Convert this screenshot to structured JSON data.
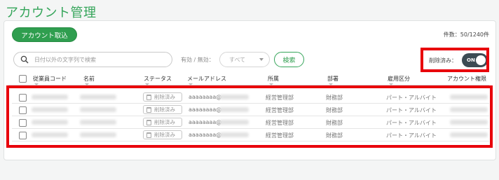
{
  "page": {
    "title": "アカウント管理"
  },
  "toolbar": {
    "import_label": "アカウント取込",
    "count_text": "件数：50/1240件",
    "search_placeholder": "日付以外の文字列で検索",
    "filter_label": "有効 / 無効：",
    "filter_value": "すべて",
    "search_button": "検索",
    "deleted_label": "削除済み：",
    "toggle_text": "ON"
  },
  "table": {
    "columns": [
      "従業員コード",
      "名前",
      "ステータス",
      "メールアドレス",
      "所属",
      "部署",
      "雇用区分",
      "アカウント権限"
    ],
    "rows": [
      {
        "status": "削除済み",
        "email": "aaaaaaaa@",
        "affiliation": "経営管理部",
        "department": "財務部",
        "employment": "パート・アルバイト"
      },
      {
        "status": "削除済み",
        "email": "aaaaaaaa@",
        "affiliation": "経営管理部",
        "department": "財務部",
        "employment": "パート・アルバイト"
      },
      {
        "status": "削除済み",
        "email": "aaaaaaaa@",
        "affiliation": "経営管理部",
        "department": "財務部",
        "employment": "パート・アルバイト"
      },
      {
        "status": "削除済み",
        "email": "aaaaaaaa@",
        "affiliation": "経営管理部",
        "department": "財務部",
        "employment": "パート・アルバイト"
      }
    ]
  },
  "colors": {
    "brand_green": "#35a55a",
    "highlight_red": "#e8000b",
    "toggle_dark": "#3c4b53"
  },
  "icons": [
    "search-icon",
    "chevron-down-icon",
    "trash-icon"
  ]
}
